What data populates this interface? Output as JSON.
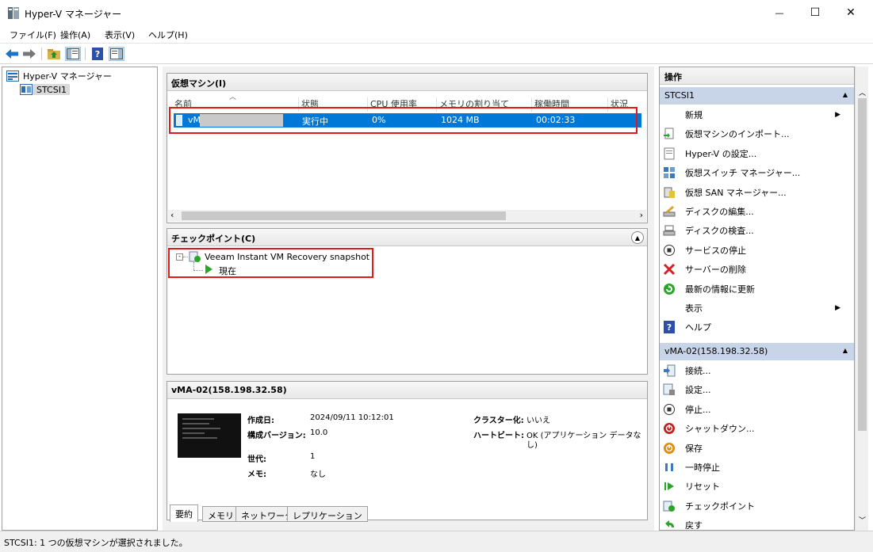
{
  "window": {
    "title": "Hyper-V マネージャー",
    "minimize": "—",
    "maximize": "☐",
    "close": "✕"
  },
  "menu": [
    "ファイル(F)",
    "操作(A)",
    "表示(V)",
    "ヘルプ(H)"
  ],
  "tree": {
    "root": "Hyper-V マネージャー",
    "server": "STCSI1"
  },
  "vm_panel": {
    "header": "仮想マシン(I)",
    "columns": [
      "名前",
      "状態",
      "CPU 使用率",
      "メモリの割り当て",
      "稼働時間",
      "状況"
    ],
    "rows": [
      {
        "name": "vM",
        "state": "実行中",
        "cpu": "0%",
        "memory": "1024 MB",
        "uptime": "00:02:33",
        "status": ""
      }
    ]
  },
  "checkpoint_panel": {
    "header": "チェックポイント(C)",
    "snapshot": "Veeam Instant VM Recovery snapshot",
    "current": "現在"
  },
  "details_panel": {
    "header": "vMA-02(158.198.32.58)",
    "created_label": "作成日:",
    "created_value": "2024/09/11 10:12:01",
    "config_label": "構成バージョン:",
    "config_value": "10.0",
    "generation_label": "世代:",
    "generation_value": "1",
    "notes_label": "メモ:",
    "notes_value": "なし",
    "cluster_label": "クラスター化:",
    "cluster_value": "いいえ",
    "heartbeat_label": "ハートビート:",
    "heartbeat_value_1": "OK (アプリケーション データな",
    "heartbeat_value_2": "し)",
    "tabs": [
      "要約",
      "メモリ",
      "ネットワーク",
      "レプリケーション"
    ]
  },
  "actions": {
    "title": "操作",
    "server_group": "STCSI1",
    "server_items": [
      {
        "label": "新規",
        "icon": "blank",
        "submenu": true
      },
      {
        "label": "仮想マシンのインポート...",
        "icon": "import-icon"
      },
      {
        "label": "Hyper-V の設定...",
        "icon": "settings-doc-icon"
      },
      {
        "label": "仮想スイッチ マネージャー...",
        "icon": "switch-icon"
      },
      {
        "label": "仮想 SAN マネージャー...",
        "icon": "san-icon"
      },
      {
        "label": "ディスクの編集...",
        "icon": "edit-disk-icon"
      },
      {
        "label": "ディスクの検査...",
        "icon": "inspect-disk-icon"
      },
      {
        "label": "サービスの停止",
        "icon": "stop-icon"
      },
      {
        "label": "サーバーの削除",
        "icon": "delete-x-icon"
      },
      {
        "label": "最新の情報に更新",
        "icon": "refresh-icon"
      },
      {
        "label": "表示",
        "icon": "blank",
        "submenu": true
      },
      {
        "label": "ヘルプ",
        "icon": "help-icon"
      }
    ],
    "vm_group": "vMA-02(158.198.32.58)",
    "vm_items": [
      {
        "label": "接続...",
        "icon": "connect-icon"
      },
      {
        "label": "設定...",
        "icon": "vm-settings-icon"
      },
      {
        "label": "停止...",
        "icon": "stop-icon"
      },
      {
        "label": "シャットダウン...",
        "icon": "shutdown-icon"
      },
      {
        "label": "保存",
        "icon": "save-icon"
      },
      {
        "label": "一時停止",
        "icon": "pause-icon"
      },
      {
        "label": "リセット",
        "icon": "reset-icon"
      },
      {
        "label": "チェックポイント",
        "icon": "checkpoint-icon"
      },
      {
        "label": "戻す",
        "icon": "revert-icon"
      }
    ]
  },
  "status": {
    "text": "STCSI1:  1 つの仮想マシンが選択されました。"
  },
  "colors": {
    "selection": "#0078d7",
    "highlight_box": "#e0191a",
    "group_header": "#c8d4e8"
  }
}
